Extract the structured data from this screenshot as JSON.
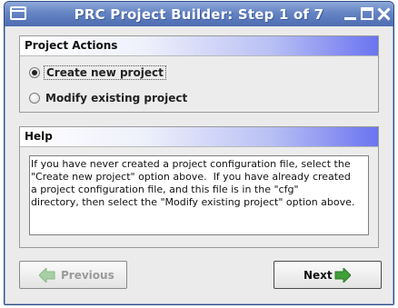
{
  "window": {
    "title": "PRC Project Builder: Step 1 of 7"
  },
  "actions_panel": {
    "header": "Project Actions",
    "options": [
      {
        "label": "Create new project",
        "selected": true
      },
      {
        "label": "Modify existing project",
        "selected": false
      }
    ]
  },
  "help_panel": {
    "header": "Help",
    "text": "If you have never created a project configuration file, select the\n\"Create new project\" option above.  If you have already created\na project configuration file, and this file is in the \"cfg\"\ndirectory, then select the \"Modify existing project\" option above."
  },
  "buttons": {
    "previous": {
      "label": "Previous",
      "enabled": false,
      "icon": "left-arrow-icon"
    },
    "next": {
      "label": "Next",
      "enabled": true,
      "icon": "right-arrow-icon"
    }
  },
  "colors": {
    "arrow_enabled": "#3fa03a",
    "arrow_disabled": "#a9cfa5",
    "title_bar": "#6584c4"
  }
}
